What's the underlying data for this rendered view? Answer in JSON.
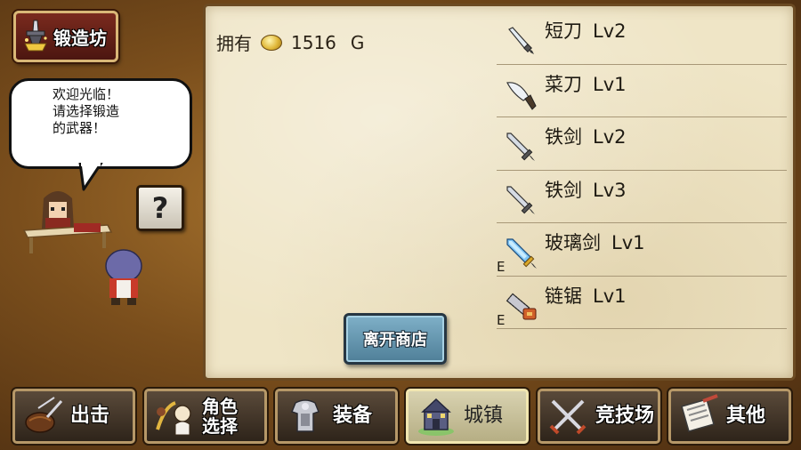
{
  "shop": {
    "title": "锻造坊",
    "icon": "anvil-icon"
  },
  "npc": {
    "speech_lines": [
      "欢迎光临！",
      "请选择锻造",
      "的武器！"
    ]
  },
  "help_button": {
    "label": "?"
  },
  "wallet": {
    "label": "拥有",
    "amount": "1516",
    "unit": "G",
    "icon": "gold-coin-icon"
  },
  "items": [
    {
      "name": "短刀",
      "level": "Lv2",
      "equipped": "",
      "icon": "dagger-icon"
    },
    {
      "name": "菜刀",
      "level": "Lv1",
      "equipped": "",
      "icon": "kitchen-knife-icon"
    },
    {
      "name": "铁剑",
      "level": "Lv2",
      "equipped": "",
      "icon": "iron-sword-icon"
    },
    {
      "name": "铁剑",
      "level": "Lv3",
      "equipped": "",
      "icon": "iron-sword-icon"
    },
    {
      "name": "玻璃剑",
      "level": "Lv1",
      "equipped": "E",
      "icon": "glass-sword-icon"
    },
    {
      "name": "链锯",
      "level": "Lv1",
      "equipped": "E",
      "icon": "chainsaw-icon"
    }
  ],
  "leave_button": {
    "label": "离开商店"
  },
  "nav": {
    "tabs": [
      {
        "label": "出击",
        "icon": "sortie-icon",
        "active": false
      },
      {
        "label": "角色选择",
        "line1": "角色",
        "line2": "选择",
        "icon": "character-select-icon",
        "active": false
      },
      {
        "label": "装备",
        "icon": "equipment-icon",
        "active": false
      },
      {
        "label": "城镇",
        "icon": "town-icon",
        "active": true
      },
      {
        "label": "竞技场",
        "icon": "arena-icon",
        "active": false
      },
      {
        "label": "其他",
        "icon": "other-icon",
        "active": false
      }
    ]
  },
  "colors": {
    "parchment": "#efe5c6",
    "leave_button": "#5f90aa",
    "active_tab": "#c8c09a"
  }
}
